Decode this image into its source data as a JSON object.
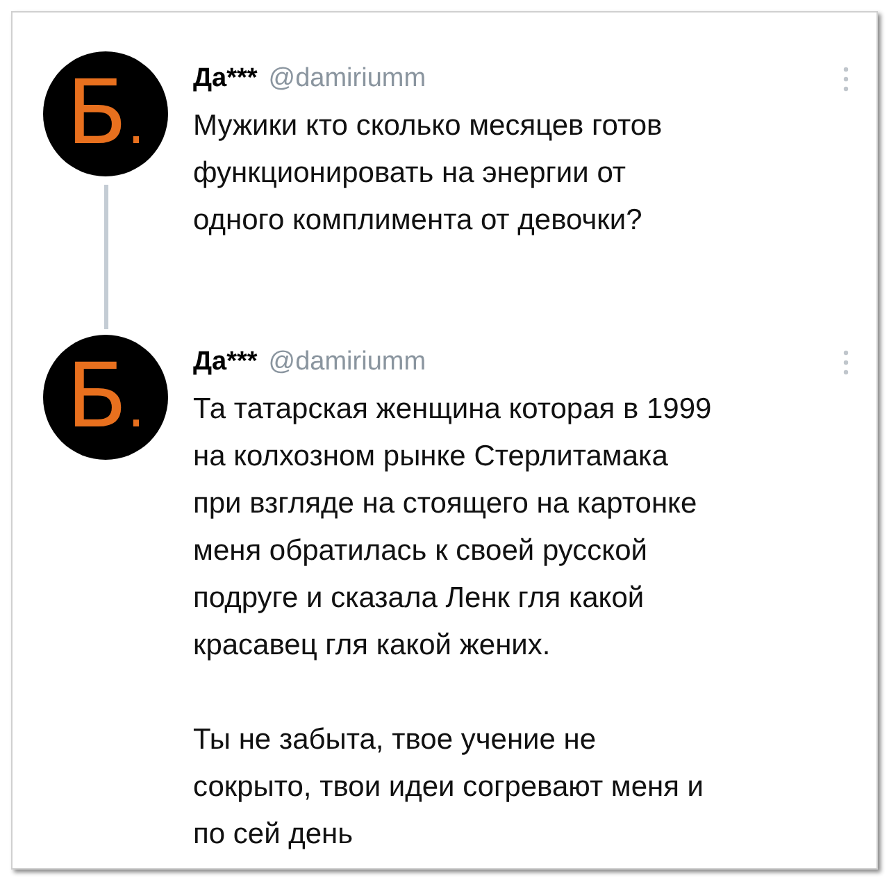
{
  "tweets": [
    {
      "avatar_text": "Б.",
      "name": "Да***",
      "handle": "@damiriumm",
      "paragraphs": [
        "Мужики кто сколько месяцев готов\nфункционировать на энергии от\nодного комплимента от девочки?"
      ]
    },
    {
      "avatar_text": "Б.",
      "name": "Да***",
      "handle": "@damiriumm",
      "paragraphs": [
        "Та татарская женщина которая в 1999\nна колхозном рынке Стерлитамака\nпри взгляде на стоящего на картонке\nменя обратилась к своей русской\nподруге и сказала Ленк гля какой\nкрасавец гля какой жених.",
        "Ты не забыта, твое учение не\nсокрыто, твои идеи согревают меня и\nпо сей день"
      ]
    }
  ]
}
